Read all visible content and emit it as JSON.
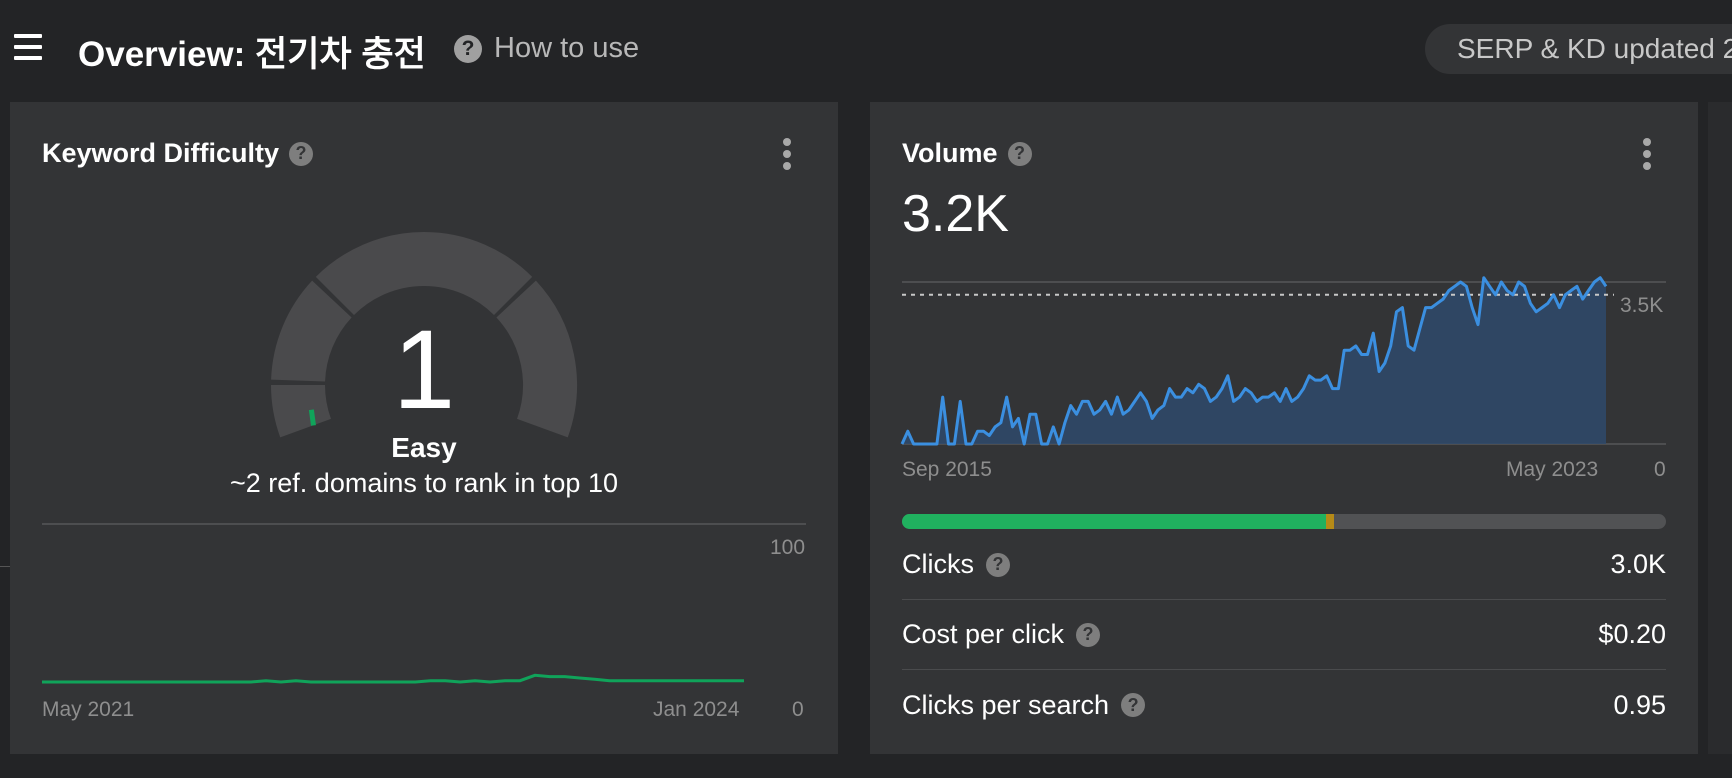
{
  "header": {
    "title": "Overview: 전기차 충전",
    "how_to_use": "How to use",
    "serp_status": "SERP & KD updated 2"
  },
  "kd_card": {
    "title": "Keyword Difficulty",
    "score": "1",
    "level": "Easy",
    "subtitle": "~2 ref. domains to rank in top 10",
    "gauge_value_fraction": 0.01,
    "accent_color": "#10a35a"
  },
  "volume_card": {
    "title": "Volume",
    "value": "3.2K",
    "clicks_split": {
      "organic_fraction": 0.555,
      "paid_fraction": 0.01,
      "organic_color": "#20b15f",
      "paid_color": "#b58a17"
    },
    "stats": [
      {
        "label": "Clicks",
        "value": "3.0K"
      },
      {
        "label": "Cost per click",
        "value": "$0.20"
      },
      {
        "label": "Clicks per search",
        "value": "0.95"
      }
    ]
  },
  "chart_data": [
    {
      "type": "line",
      "title": "",
      "x_start_label": "May 2021",
      "x_end_label": "Jan 2024",
      "ylim": [
        0,
        100
      ],
      "y_tick_labels": [
        "100",
        "0"
      ],
      "series": [
        {
          "values": [
            0,
            0,
            0,
            0,
            0,
            0,
            0,
            0,
            0,
            0,
            0,
            0,
            0,
            0,
            0,
            1,
            0,
            1,
            0,
            0,
            0,
            0,
            0,
            0,
            0,
            0,
            1,
            1,
            0,
            1,
            0,
            1,
            1,
            5,
            4,
            4,
            3,
            2,
            1,
            1,
            1,
            1,
            1,
            1,
            1,
            1,
            1,
            1
          ]
        }
      ],
      "line_color": "#10a35a"
    },
    {
      "type": "area",
      "title": "",
      "x_start_label": "Sep 2015",
      "x_end_label": "May 2023",
      "y_zero_label": "0",
      "reference_line": {
        "value": 3500,
        "label": "3.5K",
        "style": "dashed"
      },
      "ylim": [
        0,
        3800
      ],
      "series": [
        {
          "values": [
            0,
            300,
            0,
            0,
            0,
            0,
            0,
            1100,
            0,
            0,
            1000,
            0,
            0,
            300,
            300,
            200,
            400,
            500,
            1100,
            400,
            600,
            0,
            700,
            700,
            0,
            0,
            400,
            0,
            500,
            900,
            700,
            1000,
            1000,
            700,
            800,
            1000,
            700,
            1100,
            700,
            800,
            1000,
            1200,
            1000,
            600,
            800,
            900,
            1300,
            1100,
            1100,
            1300,
            1200,
            1400,
            1300,
            1000,
            1100,
            1300,
            1600,
            1000,
            1100,
            1300,
            1200,
            1000,
            1100,
            1100,
            1200,
            1000,
            1300,
            1000,
            1100,
            1300,
            1600,
            1500,
            1500,
            1600,
            1300,
            1300,
            2200,
            2200,
            2300,
            2100,
            2100,
            2600,
            1700,
            1900,
            2300,
            3100,
            3200,
            2300,
            2200,
            2700,
            3200,
            3200,
            3300,
            3400,
            3600,
            3700,
            3800,
            3700,
            3200,
            2800,
            3900,
            3700,
            3500,
            3800,
            3600,
            3500,
            3800,
            3700,
            3300,
            3100,
            3200,
            3300,
            3500,
            3200,
            3500,
            3600,
            3700,
            3400,
            3600,
            3800,
            3900,
            3700
          ]
        }
      ],
      "line_color": "#3b8fe0",
      "fill_color": "#2f4a6b"
    }
  ]
}
